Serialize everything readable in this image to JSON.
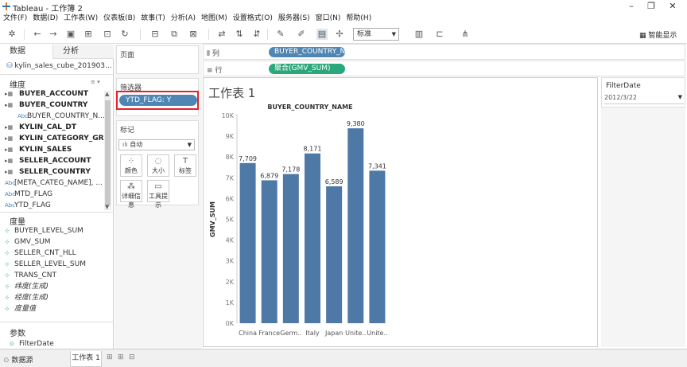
{
  "window": {
    "title": "Tableau - 工作簿 2"
  },
  "menu": [
    "文件(F)",
    "数据(D)",
    "工作表(W)",
    "仪表板(B)",
    "故事(T)",
    "分析(A)",
    "地图(M)",
    "设置格式(O)",
    "服务器(S)",
    "窗口(N)",
    "帮助(H)"
  ],
  "toolbar": {
    "view_select": "标准",
    "smart_show": "智能显示"
  },
  "data_pane": {
    "tabs": [
      "数据",
      "分析"
    ],
    "datasource": "kylin_sales_cube_201903...",
    "dimensions_header": "维度",
    "dimensions": [
      {
        "label": "BUYER_ACCOUNT",
        "style": "bold"
      },
      {
        "label": "BUYER_COUNTRY",
        "style": "bold"
      },
      {
        "label": "BUYER_COUNTRY_N...",
        "style": "child"
      },
      {
        "label": "KYLIN_CAL_DT",
        "style": "bold"
      },
      {
        "label": "KYLIN_CATEGORY_GR...",
        "style": "bold"
      },
      {
        "label": "KYLIN_SALES",
        "style": "bold"
      },
      {
        "label": "SELLER_ACCOUNT",
        "style": "bold"
      },
      {
        "label": "SELLER_COUNTRY",
        "style": "bold"
      },
      {
        "label": "[META_CATEG_NAME], ...",
        "style": "normal"
      },
      {
        "label": "MTD_FLAG",
        "style": "normal"
      },
      {
        "label": "YTD_FLAG",
        "style": "normal"
      }
    ],
    "measures_header": "度量",
    "measures": [
      {
        "label": "BUYER_LEVEL_SUM",
        "style": "normal"
      },
      {
        "label": "GMV_SUM",
        "style": "normal"
      },
      {
        "label": "SELLER_CNT_HLL",
        "style": "normal"
      },
      {
        "label": "SELLER_LEVEL_SUM",
        "style": "normal"
      },
      {
        "label": "TRANS_CNT",
        "style": "normal"
      },
      {
        "label": "纬度(生成)",
        "style": "italic"
      },
      {
        "label": "经度(生成)",
        "style": "italic"
      },
      {
        "label": "度量值",
        "style": "italic"
      }
    ],
    "params_header": "参数",
    "params": [
      {
        "label": "FilterDate"
      }
    ]
  },
  "shelves": {
    "pages_title": "页面",
    "filters_title": "筛选器",
    "filter_pill": "YTD_FLAG: Y",
    "marks_title": "标记",
    "marks_type": "自动",
    "mark_buttons": [
      "颜色",
      "大小",
      "标签",
      "详细信息",
      "工具提示"
    ],
    "columns_label": "列",
    "columns_pill": "BUYER_COUNTRY_N..",
    "rows_label": "行",
    "rows_pill": "聚合(GMV_SUM)"
  },
  "sheet": {
    "title": "工作表 1"
  },
  "filter_card": {
    "title": "FilterDate",
    "value": "2012/3/22"
  },
  "bottom": {
    "datasource_tab": "数据源",
    "sheet_tab": "工作表 1"
  },
  "colors": {
    "bar": "#4e79a7",
    "pill_dim": "#4f86b4",
    "pill_measure": "#2aa87b",
    "highlight": "#e8202a"
  },
  "chart_data": {
    "type": "bar",
    "title": "BUYER_COUNTRY_NAME",
    "ylabel": "GMV_SUM",
    "categories": [
      "China",
      "France",
      "Germ..",
      "Italy",
      "Japan",
      "Unite..",
      "Unite.."
    ],
    "values": [
      7709,
      6879,
      7178,
      8171,
      6589,
      9380,
      7341
    ],
    "data_labels": [
      "7,709",
      "6,879",
      "7,178",
      "8,171",
      "6,589",
      "9,380",
      "7,341"
    ],
    "ylim": [
      0,
      10000
    ],
    "yticks": [
      "0K",
      "1K",
      "2K",
      "3K",
      "4K",
      "5K",
      "6K",
      "7K",
      "8K",
      "9K",
      "10K"
    ],
    "grid": false
  }
}
